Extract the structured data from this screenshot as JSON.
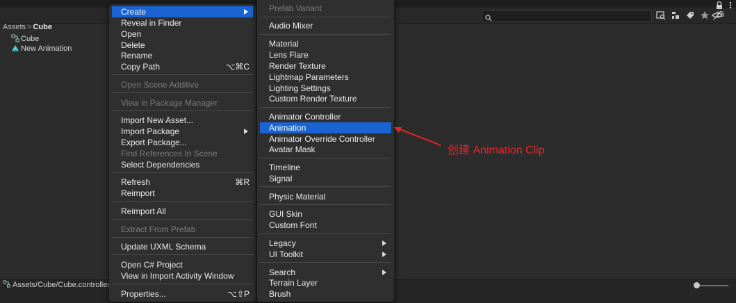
{
  "breadcrumb": {
    "root": "Assets",
    "separator": ">",
    "current": "Cube"
  },
  "assets": [
    {
      "label": "Cube",
      "icon": "animator-controller-icon"
    },
    {
      "label": "New Animation",
      "icon": "animation-clip-icon"
    }
  ],
  "status": {
    "path": "Assets/Cube/Cube.controller"
  },
  "toolbar": {
    "hidden_count": "15"
  },
  "menu1": {
    "create": "Create",
    "reveal": "Reveal in Finder",
    "open": "Open",
    "delete": "Delete",
    "rename": "Rename",
    "copy_path": "Copy Path",
    "copy_path_shortcut": "⌥⌘C",
    "open_scene_additive": "Open Scene Additive",
    "view_package_manager": "View in Package Manager",
    "import_new_asset": "Import New Asset...",
    "import_package": "Import Package",
    "export_package": "Export Package...",
    "find_references": "Find References In Scene",
    "select_dependencies": "Select Dependencies",
    "refresh": "Refresh",
    "refresh_shortcut": "⌘R",
    "reimport": "Reimport",
    "reimport_all": "Reimport All",
    "extract_from_prefab": "Extract From Prefab",
    "update_uxml": "Update UXML Schema",
    "open_csharp": "Open C# Project",
    "view_import_activity": "View in Import Activity Window",
    "properties": "Properties...",
    "properties_shortcut": "⌥⇧P"
  },
  "menu2": {
    "prefab_variant": "Prefab Variant",
    "audio_mixer": "Audio Mixer",
    "material": "Material",
    "lens_flare": "Lens Flare",
    "render_texture": "Render Texture",
    "lightmap_parameters": "Lightmap Parameters",
    "lighting_settings": "Lighting Settings",
    "custom_render_texture": "Custom Render Texture",
    "animator_controller": "Animator Controller",
    "animation": "Animation",
    "animator_override_controller": "Animator Override Controller",
    "avatar_mask": "Avatar Mask",
    "timeline": "Timeline",
    "signal": "Signal",
    "physic_material": "Physic Material",
    "gui_skin": "GUI Skin",
    "custom_font": "Custom Font",
    "legacy": "Legacy",
    "ui_toolkit": "UI Toolkit",
    "search": "Search",
    "terrain_layer": "Terrain Layer",
    "brush": "Brush"
  },
  "annotation": {
    "text": "创建 Animation Clip",
    "color": "#e8262a"
  },
  "colors": {
    "highlight": "#1964d2",
    "menu_bg": "#2f2f2f",
    "panel_bg": "#2c2c2c"
  }
}
